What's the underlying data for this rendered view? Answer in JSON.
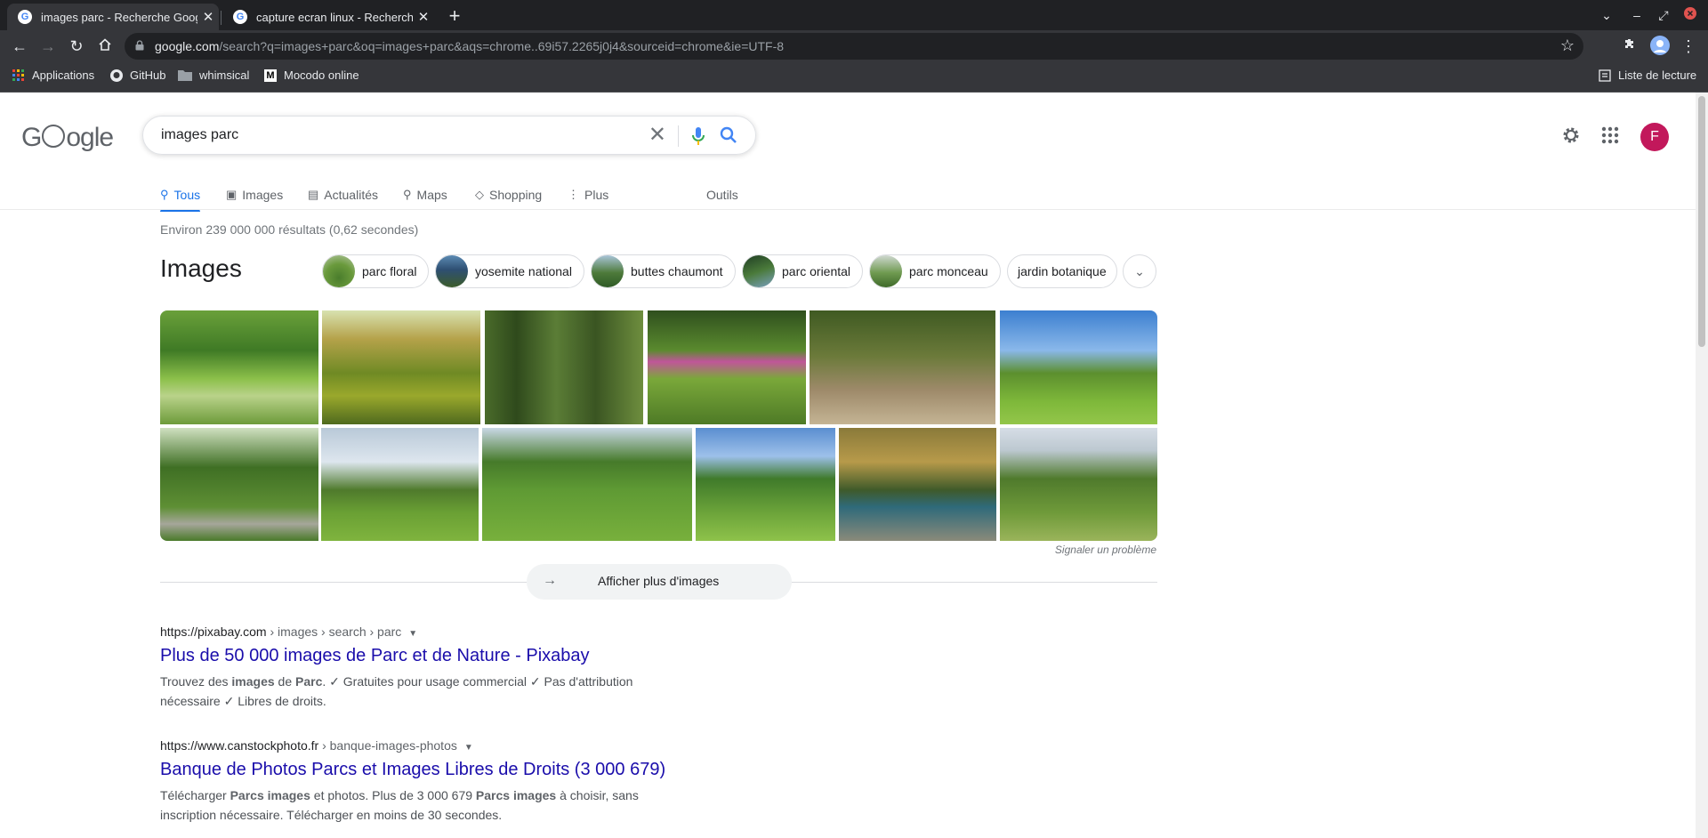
{
  "browser": {
    "tabs": [
      {
        "title": "images parc - Recherche Google",
        "active": true
      },
      {
        "title": "capture ecran linux - Recherche Google",
        "active": false
      }
    ],
    "new_tab": "+",
    "url_host": "google.com",
    "url_rest": "/search?q=images+parc&oq=images+parc&aqs=chrome..69i57.2265j0j4&sourceid=chrome&ie=UTF-8",
    "bookmarks": [
      "Applications",
      "GitHub",
      "whimsical",
      "Mocodo online"
    ],
    "reading_list": "Liste de lecture"
  },
  "search": {
    "query": "images parc",
    "avatar_letter": "F",
    "tabs": [
      "Tous",
      "Images",
      "Actualités",
      "Maps",
      "Shopping",
      "Plus"
    ],
    "tools": "Outils",
    "stats": "Environ 239 000 000 résultats (0,62 secondes)"
  },
  "images_section": {
    "heading": "Images",
    "chips": [
      "parc floral",
      "yosemite national",
      "buttes chaumont",
      "parc oriental",
      "parc monceau",
      "jardin botanique"
    ],
    "report": "Signaler un problème",
    "more_button": "Afficher plus d'images"
  },
  "results": [
    {
      "host": "https://pixabay.com",
      "path": " › images › search › parc",
      "title": "Plus de 50 000 images de Parc et de Nature - Pixabay",
      "snippet_parts": [
        "Trouvez des ",
        "images",
        " de ",
        "Parc",
        ". ✓ Gratuites pour usage commercial ✓ Pas d'attribution nécessaire ✓ Libres de droits."
      ]
    },
    {
      "host": "https://www.canstockphoto.fr",
      "path": " › banque-images-photos",
      "title": "Banque de Photos Parcs et Images Libres de Droits (3 000 679)",
      "snippet_parts": [
        "Télécharger ",
        "Parcs images",
        " et photos. Plus de 3 000 679 ",
        "Parcs images",
        " à choisir, sans inscription nécessaire. Télécharger en moins de 30 secondes."
      ]
    }
  ],
  "colors": {
    "link": "#1a0dab",
    "accent": "#1a73e8",
    "avatar": "#c2185b"
  }
}
